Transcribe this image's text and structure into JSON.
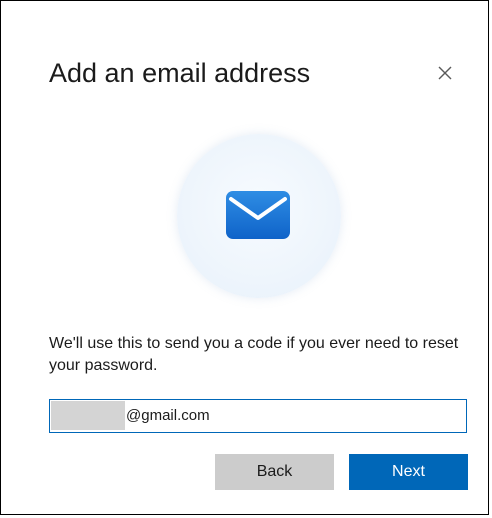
{
  "dialog": {
    "title": "Add an email address",
    "close_icon": "close-icon",
    "hero_icon": "mail-icon",
    "description": "We'll use this to send you a code if you ever need to reset your password.",
    "email": {
      "value": "@gmail.com"
    },
    "buttons": {
      "back_label": "Back",
      "next_label": "Next"
    }
  },
  "colors": {
    "accent": "#0067b8",
    "secondary_button": "#cccccc",
    "text": "#1b1b1b"
  }
}
